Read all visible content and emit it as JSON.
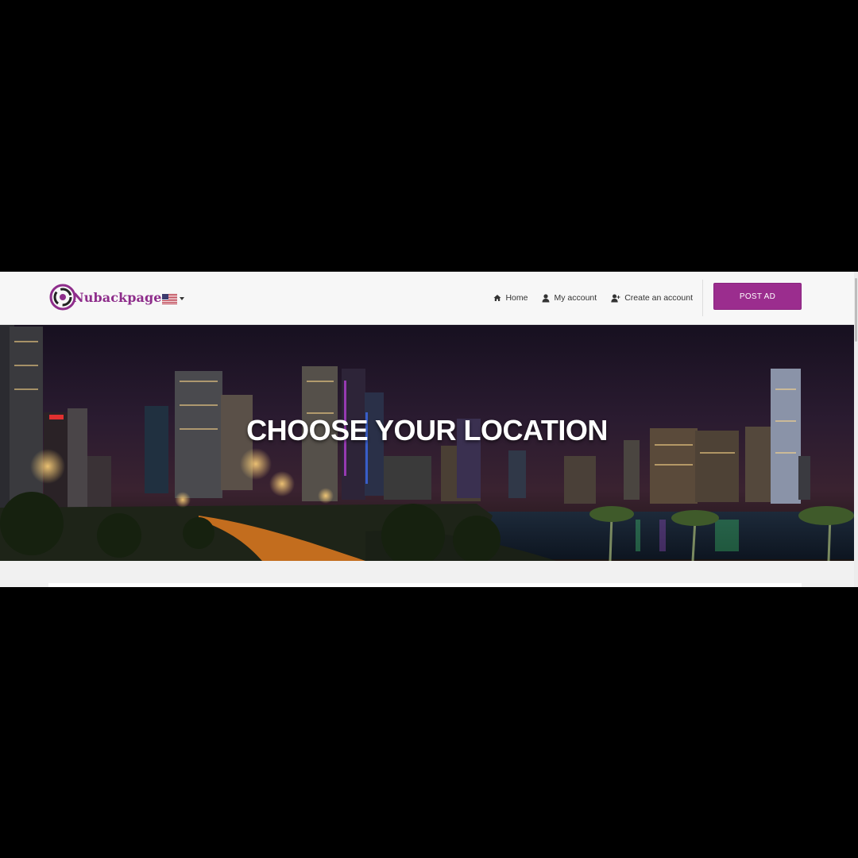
{
  "brand": {
    "name": "Nubackpage",
    "color": "#8e2d8b"
  },
  "language": {
    "flag": "us-flag-icon"
  },
  "nav": {
    "home_label": "Home",
    "my_account_label": "My account",
    "create_account_label": "Create an account",
    "post_ad_label": "POST AD"
  },
  "hero": {
    "title": "CHOOSE YOUR LOCATION"
  },
  "colors": {
    "accent": "#9b2d8e",
    "page_bg": "#000000"
  }
}
